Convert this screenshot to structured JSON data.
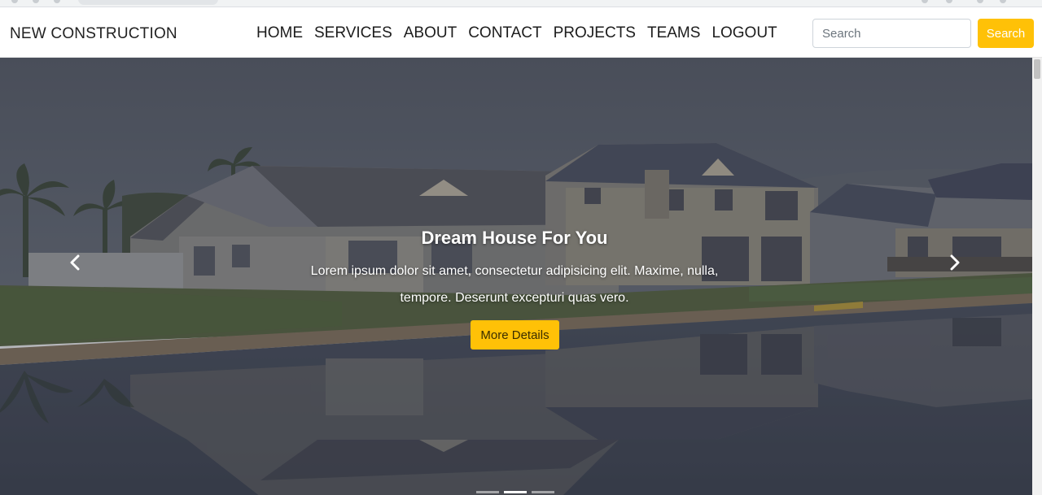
{
  "navbar": {
    "brand": "NEW CONSTRUCTION",
    "links": [
      {
        "label": "HOME"
      },
      {
        "label": "SERVICES"
      },
      {
        "label": "ABOUT"
      },
      {
        "label": "CONTACT"
      },
      {
        "label": "PROJECTS"
      },
      {
        "label": "TEAMS"
      },
      {
        "label": "LOGOUT"
      }
    ],
    "search": {
      "placeholder": "Search",
      "button_label": "Search"
    }
  },
  "hero": {
    "title": "Dream House For You",
    "text": "Lorem ipsum dolor sit amet, consectetur adipisicing elit. Maxime, nulla, tempore. Deserunt excepturi quas vero.",
    "button_label": "More Details",
    "active_slide": 2,
    "slide_count": 3
  },
  "colors": {
    "accent": "#ffc107",
    "overlay": "#3c4250"
  },
  "icons": {
    "prev": "chevron-left-icon",
    "next": "chevron-right-icon"
  }
}
